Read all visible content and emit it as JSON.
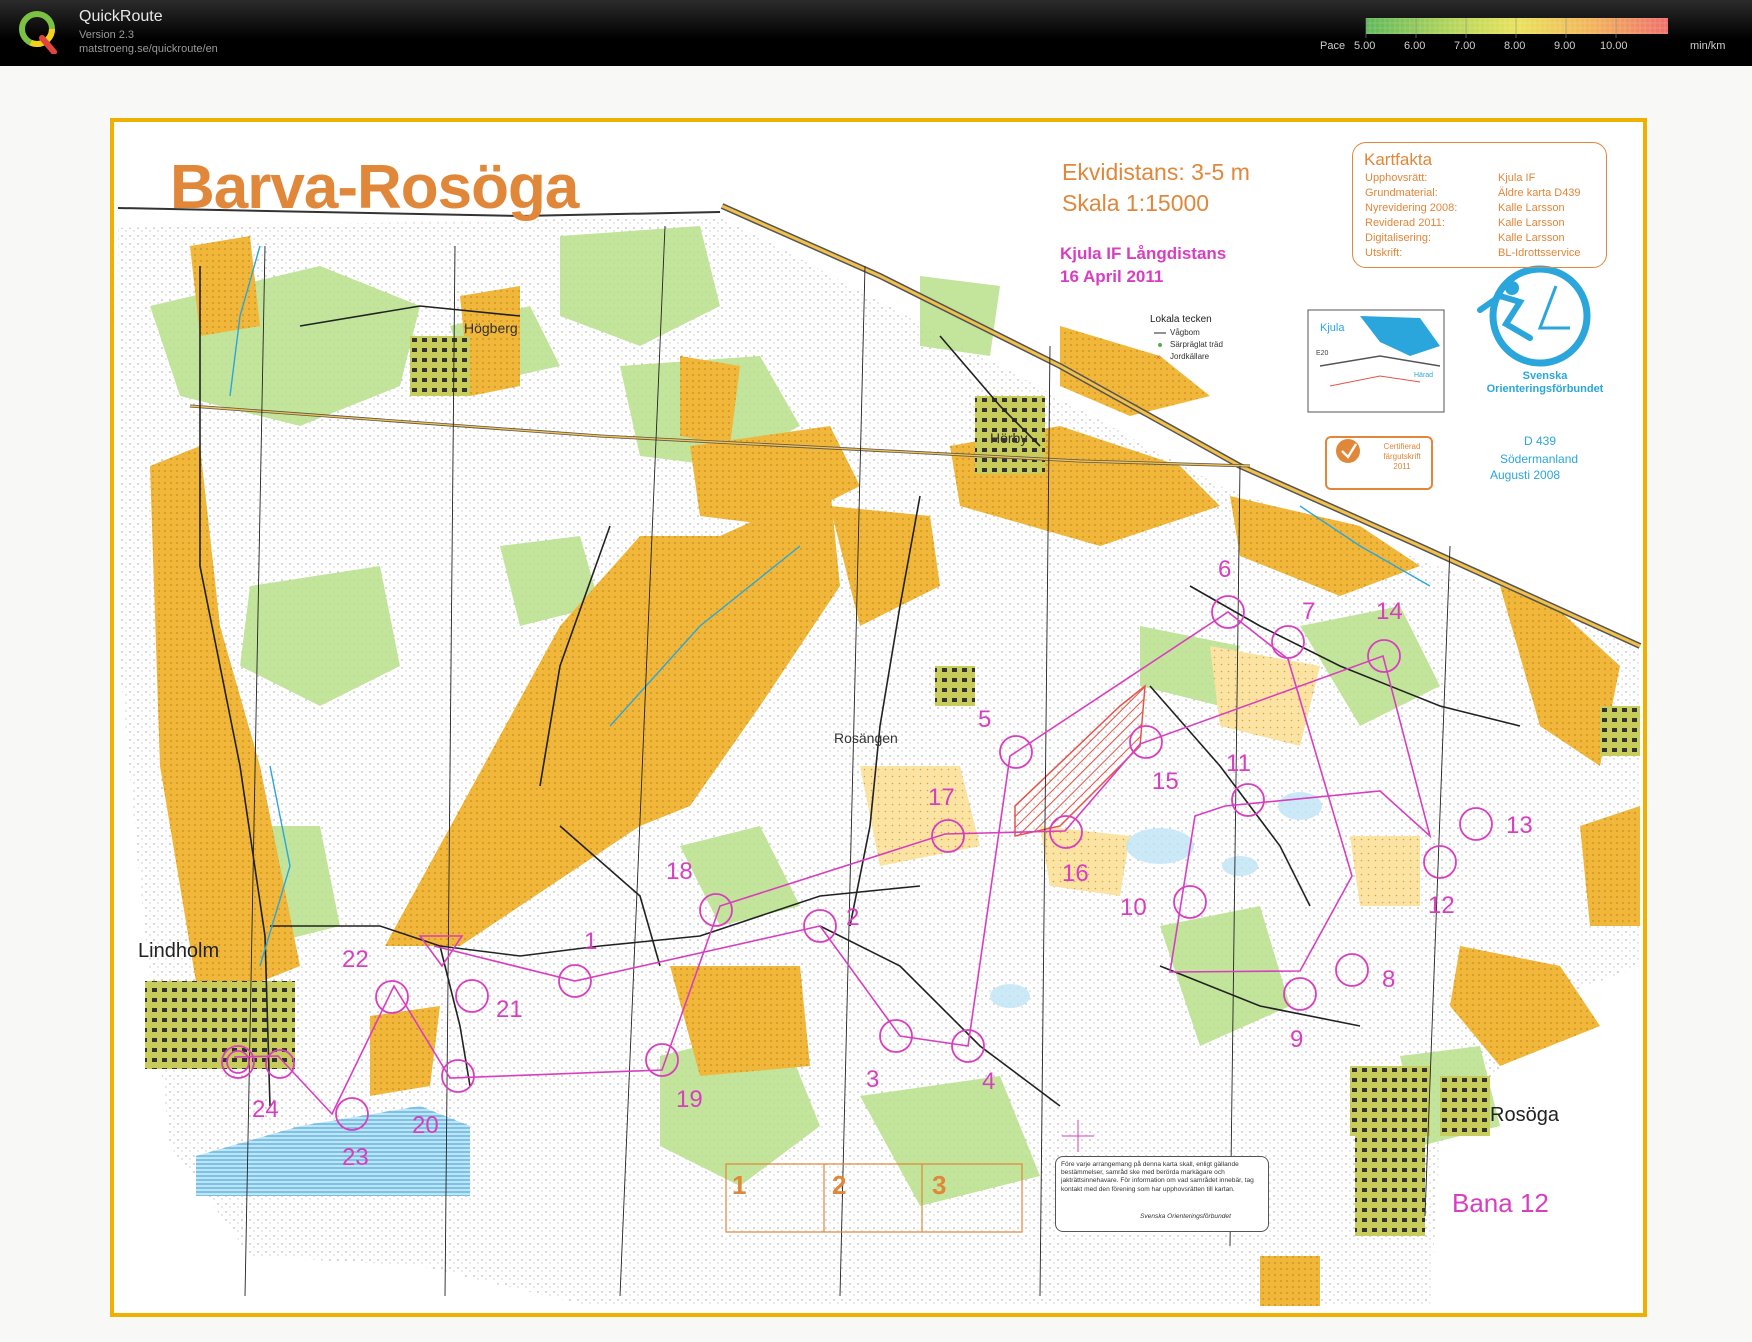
{
  "app": {
    "name": "QuickRoute",
    "version": "Version 2.3",
    "url": "matstroeng.se/quickroute/en"
  },
  "pace_scale": {
    "label": "Pace",
    "ticks": [
      "5.00",
      "6.00",
      "7.00",
      "8.00",
      "9.00",
      "10.00"
    ],
    "unit": "min/km",
    "colors": [
      "#5fb85a",
      "#9fcc5a",
      "#e6e35a",
      "#f2b85a",
      "#ef7f6a"
    ]
  },
  "map": {
    "title": "Barva-Rosöga",
    "contour_interval": "Ekvidistans: 3-5 m",
    "scale": "Skala 1:15000",
    "event_name": "Kjula IF Långdistans",
    "event_date": "16 April 2011",
    "local_symbols": {
      "title": "Lokala tecken",
      "items": [
        "Vågbom",
        "Särpräglat träd",
        "Jordkällare"
      ]
    },
    "kartfakta": {
      "title": "Kartfakta",
      "rows": [
        {
          "label": "Upphovsrätt:",
          "value": "Kjula IF"
        },
        {
          "label": "Grundmaterial:",
          "value": "Äldre karta D439"
        },
        {
          "label": "Nyrevidering 2008:",
          "value": "Kalle Larsson"
        },
        {
          "label": "Reviderad 2011:",
          "value": "Kalle Larsson"
        },
        {
          "label": "Digitalisering:",
          "value": "Kalle Larsson"
        },
        {
          "label": "Utskrift:",
          "value": "BL-Idrottsservice"
        }
      ]
    },
    "inset_labels": [
      "Kjula",
      "E20",
      "Härad"
    ],
    "federation": "Svenska Orienteringsförbundet",
    "certificate": "Certifierad färgutskrift 2011",
    "map_id": "D 439",
    "map_region": "Södermanland",
    "map_date": "Augusti 2008",
    "places": {
      "hogberg": "Högberg",
      "horby": "Hörby",
      "rosangen": "Rosängen",
      "lindholm": "Lindholm",
      "rosoga": "Rosöga"
    },
    "course_name": "Bana 12",
    "leg_boxes": [
      "1",
      "2",
      "3"
    ],
    "notice": "Före varje arrangemang på denna karta skall, enligt gällande bestämmelser, samråd ske med berörda markägare och jakträttsinnehavare. För information om vad samrådet innebär, tag kontakt med den förening som har upphovsrätten till kartan.",
    "notice_sign": "Svenska Orienteringsförbundet"
  },
  "course": {
    "controls": [
      {
        "num": "1"
      },
      {
        "num": "2"
      },
      {
        "num": "3"
      },
      {
        "num": "4"
      },
      {
        "num": "5"
      },
      {
        "num": "6"
      },
      {
        "num": "7"
      },
      {
        "num": "8"
      },
      {
        "num": "9"
      },
      {
        "num": "10"
      },
      {
        "num": "11"
      },
      {
        "num": "12"
      },
      {
        "num": "13"
      },
      {
        "num": "14"
      },
      {
        "num": "15"
      },
      {
        "num": "16"
      },
      {
        "num": "17"
      },
      {
        "num": "18"
      },
      {
        "num": "19"
      },
      {
        "num": "20"
      },
      {
        "num": "21"
      },
      {
        "num": "22"
      },
      {
        "num": "23"
      },
      {
        "num": "24"
      }
    ]
  }
}
